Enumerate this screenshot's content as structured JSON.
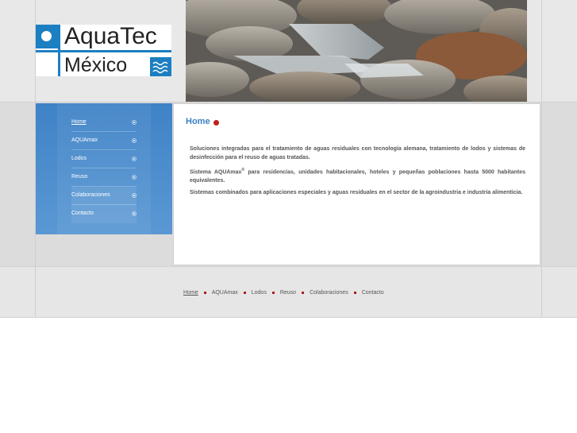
{
  "logo": {
    "line1": "AquaTec",
    "line2": "México"
  },
  "sidebar": {
    "items": [
      {
        "label": "Home"
      },
      {
        "label": "AQUAmax"
      },
      {
        "label": "Lodos"
      },
      {
        "label": "Reuso"
      },
      {
        "label": "Colaboraciones"
      },
      {
        "label": "Contacto"
      }
    ]
  },
  "content": {
    "title": "Home",
    "p1": "Soluciones integradas para el tratamiento de aguas residuales con tecnología alemana, tratamiento de lodos y sistemas de desinfección para el reuso de aguas tratadas.",
    "p2_a": "Sistema AQUAmax",
    "p2_sup": "®",
    "p2_b": " para residencias, unidades habitacionales, hoteles y pequeñas poblaciones hasta 5000 habitantes equivalentes.",
    "p3": "Sistemas combinados para aplicaciones especiales y aguas residuales en el sector de la agroindustria e industria alimenticia."
  },
  "footer": {
    "links": [
      "Home",
      "AQUAmax",
      "Lodos",
      "Reuso",
      "Colaboraciones",
      "Contacto"
    ]
  },
  "colors": {
    "accent": "#3b7fc4",
    "sidebar": "#4a8bcd",
    "bullet": "#c0201c",
    "logo_blue": "#1c7fc1"
  }
}
